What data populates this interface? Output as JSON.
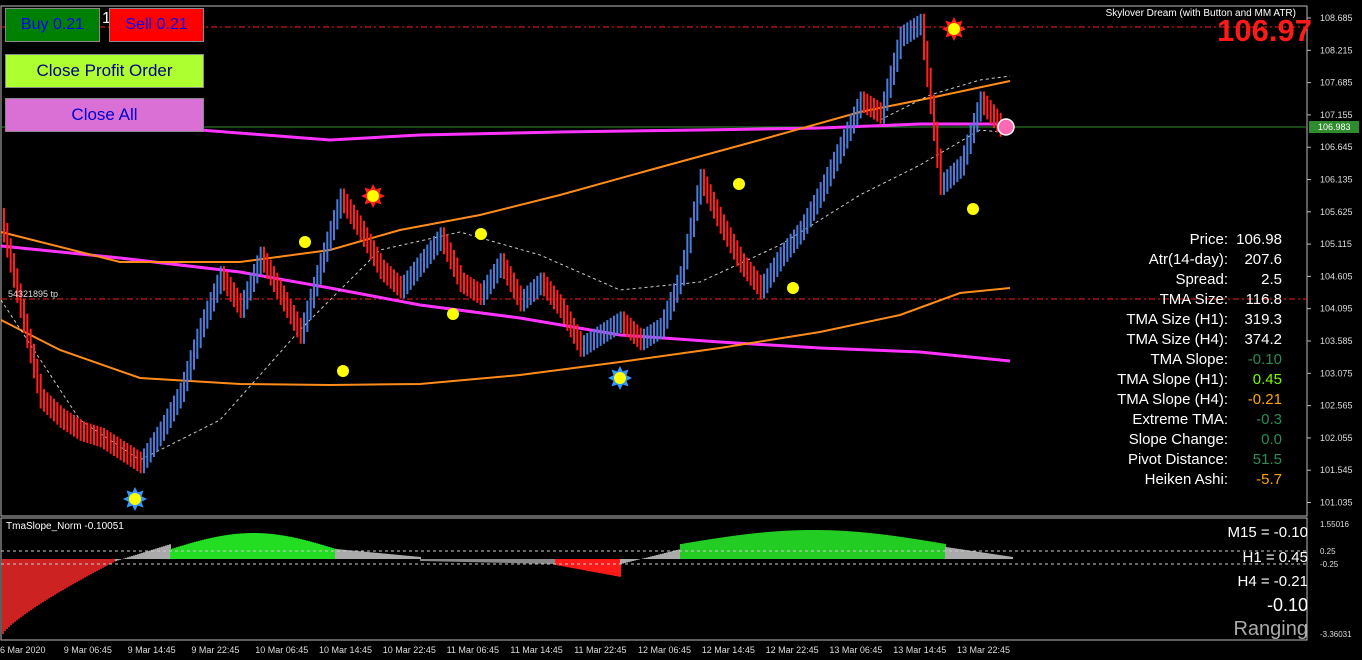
{
  "window": {
    "indicator_title": "Skylover Dream (with Button and MM ATR)"
  },
  "buttons": {
    "buy_label": "Buy 0.21",
    "sell_label": "Sell 0.21",
    "lot_digit": "1",
    "close_profit_label": "Close Profit Order",
    "close_all_label": "Close All"
  },
  "price_display": "106.97",
  "order_line_label": "54321895 tp",
  "current_price_tag": "106.983",
  "price_axis": [
    "108.685",
    "108.215",
    "107.685",
    "107.155",
    "106.645",
    "106.135",
    "105.625",
    "105.115",
    "104.605",
    "104.095",
    "103.585",
    "103.075",
    "102.565",
    "102.055",
    "101.545",
    "101.035"
  ],
  "stats": [
    {
      "label": "Price:",
      "value": "106.98",
      "color": "#ffffff"
    },
    {
      "label": "Atr(14-day):",
      "value": "207.6",
      "color": "#ffffff"
    },
    {
      "label": "Spread:",
      "value": "2.5",
      "color": "#ffffff"
    },
    {
      "label": "TMA Size:",
      "value": "116.8",
      "color": "#ffffff"
    },
    {
      "label": "TMA Size (H1):",
      "value": "319.3",
      "color": "#ffffff"
    },
    {
      "label": "TMA Size (H4):",
      "value": "374.2",
      "color": "#ffffff"
    },
    {
      "label": "TMA Slope:",
      "value": "-0.10",
      "color": "#2e8b57"
    },
    {
      "label": "TMA Slope (H1):",
      "value": "0.45",
      "color": "#7cfc00"
    },
    {
      "label": "TMA Slope (H4):",
      "value": "-0.21",
      "color": "#ffa500"
    },
    {
      "label": "Extreme TMA:",
      "value": "-0.3",
      "color": "#2e8b57"
    },
    {
      "label": "Slope Change:",
      "value": "0.0",
      "color": "#2e8b57"
    },
    {
      "label": "Pivot Distance:",
      "value": "51.5",
      "color": "#2e8b57"
    },
    {
      "label": "Heiken Ashi:",
      "value": "-5.7",
      "color": "#ffa500"
    }
  ],
  "subwindow": {
    "title": "TmaSlope_Norm -0.10051",
    "m15": "M15 = -0.10",
    "h1": "H1 = 0.45",
    "h4": "H4 = -0.21",
    "value": "-0.10",
    "state": "Ranging",
    "axis": [
      "1.55016",
      "0.25",
      "-0.25",
      "-3.36031"
    ]
  },
  "time_axis": [
    "6 Mar 2020",
    "9 Mar 06:45",
    "9 Mar 14:45",
    "9 Mar 22:45",
    "10 Mar 06:45",
    "10 Mar 14:45",
    "10 Mar 22:45",
    "11 Mar 06:45",
    "11 Mar 14:45",
    "11 Mar 22:45",
    "12 Mar 06:45",
    "12 Mar 14:45",
    "12 Mar 22:45",
    "13 Mar 06:45",
    "13 Mar 14:45",
    "13 Mar 22:45"
  ],
  "colors": {
    "bull": "#4a7bd8",
    "bear": "#ff2020",
    "tma_band": "#ff8c1a",
    "ma_long": "#ff33ff",
    "buy_btn": "#008000",
    "sell_btn": "#ff0000"
  },
  "chart_data": {
    "type": "line",
    "series": [
      {
        "values": [
          105.6,
          104.2,
          102.8,
          102.5,
          102.3,
          102.2,
          102.0,
          101.8,
          102.3,
          102.9,
          103.9,
          104.7,
          104.2,
          105.0,
          104.4,
          103.8,
          104.9,
          105.9,
          105.4,
          104.8,
          104.5,
          104.9,
          105.3,
          104.6,
          104.4,
          104.9,
          104.3,
          104.6,
          104.2,
          103.6,
          103.8,
          104.0,
          103.7,
          103.9,
          104.7,
          106.2,
          105.5,
          104.9,
          104.5,
          105.0,
          105.4,
          106.0,
          106.7,
          107.4,
          107.2,
          108.4,
          108.6,
          106.1,
          106.4,
          107.4,
          107.0
        ]
      }
    ]
  }
}
